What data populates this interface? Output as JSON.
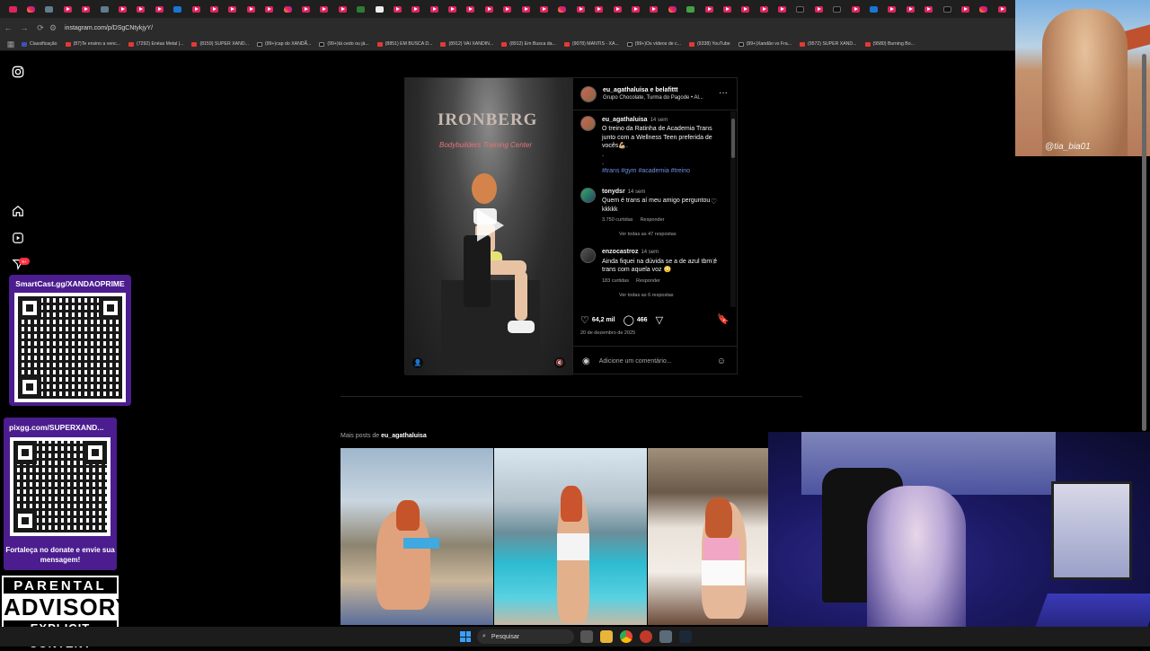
{
  "browser": {
    "url": "instagram.com/p/DSgCNtykjyY/",
    "tab_icons": [
      "menu",
      "ig",
      "gr",
      "yt",
      "yt",
      "gr",
      "yt",
      "yt",
      "yt",
      "bl",
      "yt",
      "yt",
      "yt",
      "yt",
      "yt",
      "ig",
      "yt",
      "yt",
      "yt",
      "x",
      "w",
      "yt",
      "yt",
      "yt",
      "yt",
      "yt",
      "yt",
      "yt",
      "yt",
      "yt",
      "ig",
      "yt",
      "yt",
      "yt",
      "yt",
      "yt",
      "ig",
      "gn",
      "yt",
      "yt",
      "yt",
      "yt",
      "yt",
      "tk",
      "yt",
      "tk",
      "yt",
      "bl",
      "yt",
      "yt",
      "yt",
      "tk",
      "yt",
      "ig",
      "yt"
    ],
    "bookmarks": [
      {
        "label": "Classificação",
        "kind": "bl"
      },
      {
        "label": "(87)Te ensino a venc...",
        "kind": "yt"
      },
      {
        "label": "(7292) Enéas Metal |...",
        "kind": "yt"
      },
      {
        "label": "(8159) SUPER XAND...",
        "kind": "yt"
      },
      {
        "label": "(99+)cap do XANDÃ...",
        "kind": "tk"
      },
      {
        "label": "(99+)tá cedo ou já...",
        "kind": "tk"
      },
      {
        "label": "(8851) EM BUSCA D...",
        "kind": "yt"
      },
      {
        "label": "(8912) VAI XANDIN...",
        "kind": "yt"
      },
      {
        "label": "(8912) Em Busca da...",
        "kind": "yt"
      },
      {
        "label": "(9078) MANTIS - XA...",
        "kind": "yt"
      },
      {
        "label": "(99+)Os vídeos de c...",
        "kind": "tk"
      },
      {
        "label": "(9338) YouTube",
        "kind": "yt"
      },
      {
        "label": "(99+)Xandão vs Fra...",
        "kind": "tk"
      },
      {
        "label": "(9572) SUPER XAND...",
        "kind": "yt"
      },
      {
        "label": "(9580) Burning Bo...",
        "kind": "yt"
      }
    ]
  },
  "post": {
    "media": {
      "sign": "IRONBERG",
      "sign_sub": "Bodybuilders Training Center"
    },
    "header": {
      "username": "eu_agathaluisa e belafittt",
      "subline": "Grupo Chocolate, Turma do Pagode • Al..."
    },
    "caption": {
      "user": "eu_agathaluisa",
      "time": "14 sem",
      "text": "O treino da Ratinha de Academia Trans junto com a Wellness Teen preferida de vocês💪🏼.",
      "dots": ".\n.",
      "tags": "#trans #gym #academia #treino"
    },
    "comments": [
      {
        "user": "tonydsr",
        "time": "14 sem",
        "text": "Quem é trans aí meu amigo perguntou kkkkk",
        "likes": "3.750 curtidas",
        "reply": "Responder",
        "view_more": "Ver todas as 47 respostas"
      },
      {
        "user": "enzocastroz",
        "time": "14 sem",
        "text": "Ainda fiquei na dúvida se a de azul tbm é trans com aquela voz 😳",
        "likes": "183 curtidas",
        "reply": "Responder",
        "view_more": "Ver todas as 6 respostas"
      }
    ],
    "likes": "64,2 mil",
    "comment_count": "466",
    "date": "20 de dezembro de 2025",
    "comment_placeholder": "Adicione um comentário..."
  },
  "more_posts": {
    "prefix": "Mais posts de ",
    "user": "eu_agathaluisa"
  },
  "overlays": {
    "smartcast": "SmartCast.gg/XANDAOPRIME",
    "pixgg": "pixgg.com/SUPERXAND...",
    "pix_footer": "Fortaleça no donate e envie sua mensagem!",
    "advisory": [
      "PARENTAL",
      "ADVISORY",
      "EXPLICIT CONTENT"
    ],
    "notif_badge": "9+",
    "cam_handle": "@tia_bia01"
  },
  "taskbar": {
    "search": "Pesquisar"
  }
}
